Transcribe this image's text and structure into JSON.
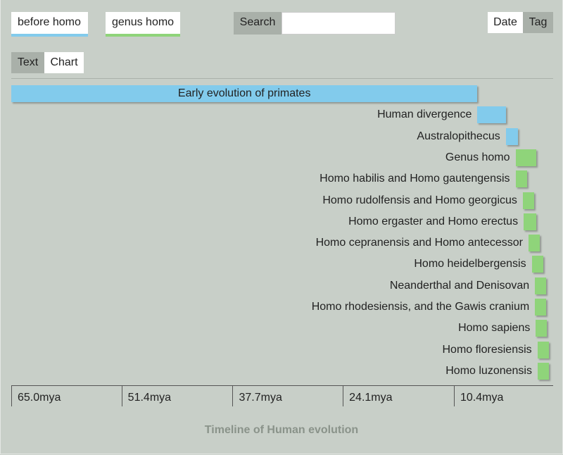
{
  "filters": {
    "before_homo": {
      "label": "before homo",
      "color": "#82cbec"
    },
    "genus_homo": {
      "label": "genus homo",
      "color": "#8fd47a"
    }
  },
  "search": {
    "label": "Search",
    "value": "",
    "placeholder": ""
  },
  "sort_toggle": {
    "date_label": "Date",
    "tag_label": "Tag",
    "active": "Date"
  },
  "view_toggle": {
    "text_label": "Text",
    "chart_label": "Chart",
    "active": "Chart"
  },
  "chart_data": {
    "type": "bar",
    "title": "Timeline of Human evolution",
    "x_unit": "mya",
    "xlim": [
      65.0,
      0.0
    ],
    "ticks": [
      65.0,
      51.4,
      37.7,
      24.1,
      10.4
    ],
    "tick_labels": [
      "65.0mya",
      "51.4mya",
      "37.7mya",
      "24.1mya",
      "10.4mya"
    ],
    "events": [
      {
        "label": "Early evolution of primates",
        "start": 65.0,
        "end": 7.5,
        "tag": "before homo"
      },
      {
        "label": "Human divergence",
        "start": 7.5,
        "end": 4.0,
        "tag": "before homo"
      },
      {
        "label": "Australopithecus",
        "start": 4.0,
        "end": 2.5,
        "tag": "before homo"
      },
      {
        "label": "Genus homo",
        "start": 2.8,
        "end": 0.2,
        "tag": "genus homo"
      },
      {
        "label": "Homo habilis and Homo gautengensis",
        "start": 2.8,
        "end": 1.5,
        "tag": "genus homo"
      },
      {
        "label": "Homo rudolfensis and Homo georgicus",
        "start": 1.9,
        "end": 0.6,
        "tag": "genus homo"
      },
      {
        "label": "Homo ergaster and Homo erectus",
        "start": 1.8,
        "end": 0.2,
        "tag": "genus homo"
      },
      {
        "label": "Homo cepranensis and Homo antecessor",
        "start": 1.2,
        "end": 0.0,
        "tag": "genus homo"
      },
      {
        "label": "Homo heidelbergensis",
        "start": 0.8,
        "end": 0.0,
        "tag": "genus homo"
      },
      {
        "label": "Neanderthal and Denisovan",
        "start": 0.4,
        "end": 0.0,
        "tag": "genus homo"
      },
      {
        "label": "Homo rhodesiensis, and the Gawis cranium",
        "start": 0.4,
        "end": 0.0,
        "tag": "genus homo"
      },
      {
        "label": "Homo sapiens",
        "start": 0.3,
        "end": 0.0,
        "tag": "genus homo"
      },
      {
        "label": "Homo floresiensis",
        "start": 0.1,
        "end": 0.0,
        "tag": "genus homo"
      },
      {
        "label": "Homo luzonensis",
        "start": 0.07,
        "end": 0.0,
        "tag": "genus homo"
      }
    ]
  }
}
